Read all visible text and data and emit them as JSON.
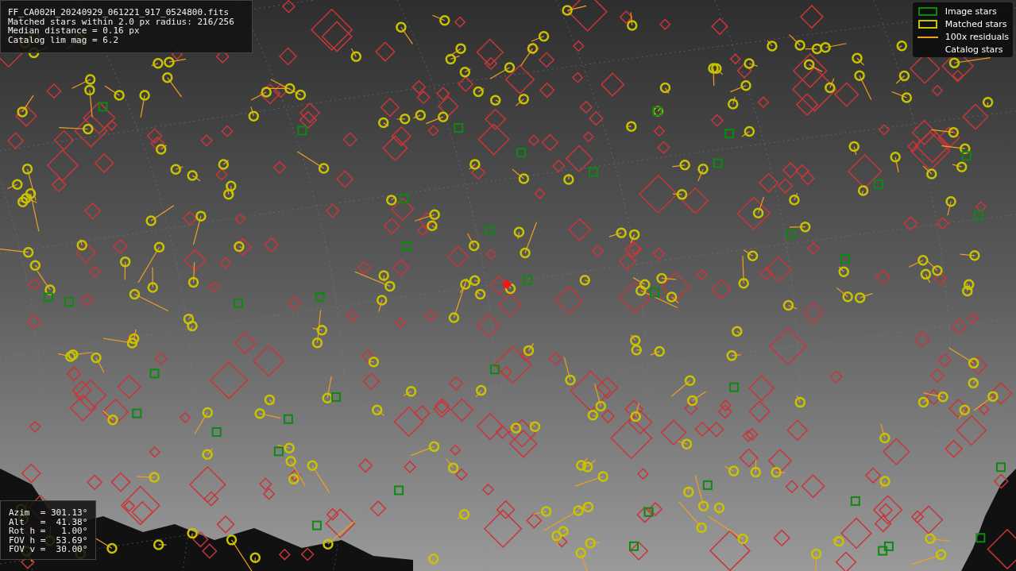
{
  "info_panel": {
    "lines": [
      "FF_CA002H_20240929_061221_917_0524800.fits",
      "Matched stars within 2.0 px radius: 216/256",
      "Median distance = 0.16 px",
      "Catalog lim mag = 6.2"
    ]
  },
  "legend": {
    "items": [
      {
        "kind": "image",
        "label": "Image stars"
      },
      {
        "kind": "matched",
        "label": "Matched stars"
      },
      {
        "kind": "residual",
        "label": "100x residuals"
      },
      {
        "kind": "catalog",
        "label": "Catalog stars"
      }
    ]
  },
  "pointing_panel": {
    "lines": [
      "Azim  = 301.13°",
      "Alt   =  41.38°",
      "Rot h =   1.00°",
      "FOV h =  53.69°",
      "FOV v =  30.00°"
    ]
  }
}
